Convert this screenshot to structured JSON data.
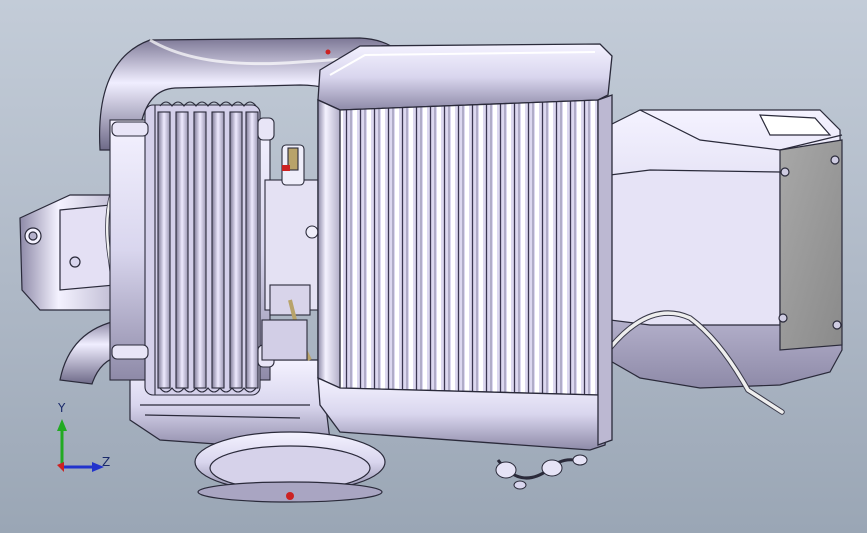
{
  "viewport": {
    "background_top": "#c3ccd8",
    "background_bottom": "#9aa6b5"
  },
  "model": {
    "part_color": "#d9d6ee",
    "edge_color": "#2a2a3a",
    "shade_color": "#8e8aa8",
    "highlight_color": "#f4f2ff",
    "plate_color": "#9c9c9c",
    "accent_red": "#cc2222",
    "accent_tan": "#b8a36a"
  },
  "triad": {
    "y_label": "Y",
    "z_label": "Z",
    "y_color": "#22aa22",
    "z_color": "#2233cc",
    "x_color": "#cc2222"
  }
}
